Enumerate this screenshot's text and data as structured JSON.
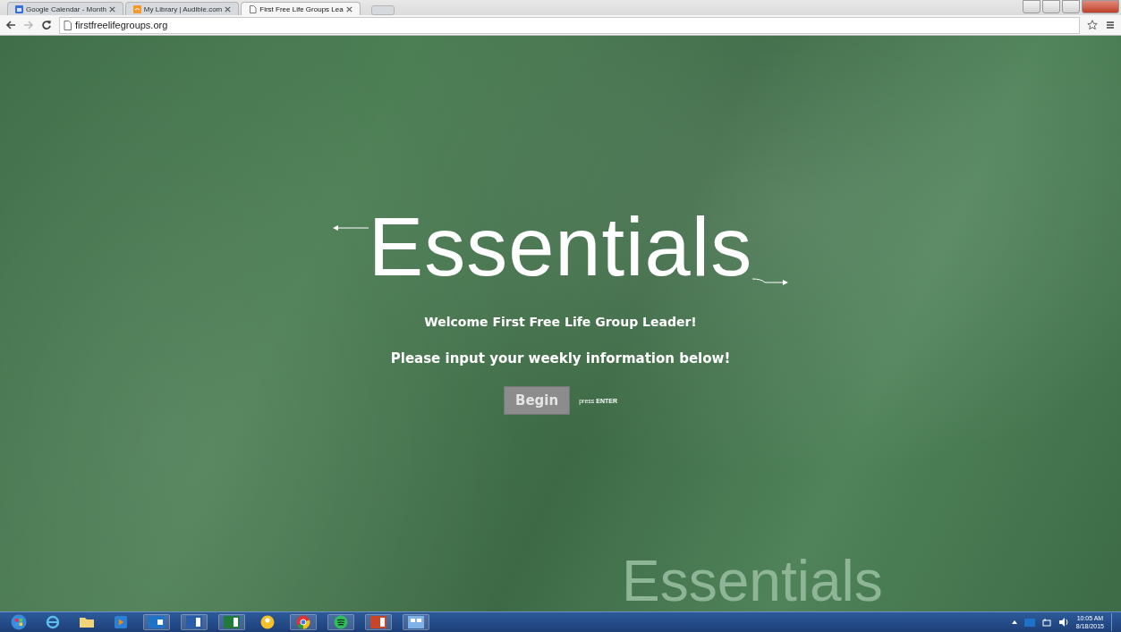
{
  "browser": {
    "tabs": [
      {
        "title": "Google Calendar - Month",
        "selected": false,
        "kind": "calendar"
      },
      {
        "title": "My Library | Audible.com",
        "selected": false,
        "kind": "audible"
      },
      {
        "title": "First Free Life Groups Lea",
        "selected": true,
        "kind": "page"
      }
    ],
    "address": "firstfreelifegroups.org"
  },
  "page": {
    "logo": "Essentials",
    "welcome": "Welcome First Free Life Group Leader!",
    "instructions": "Please input your weekly information below!",
    "begin_button": "Begin",
    "hint": "press **ENTER**",
    "background_logo": "Essentials"
  },
  "taskbar": {
    "time": "10:05 AM",
    "date": "8/18/2015"
  }
}
